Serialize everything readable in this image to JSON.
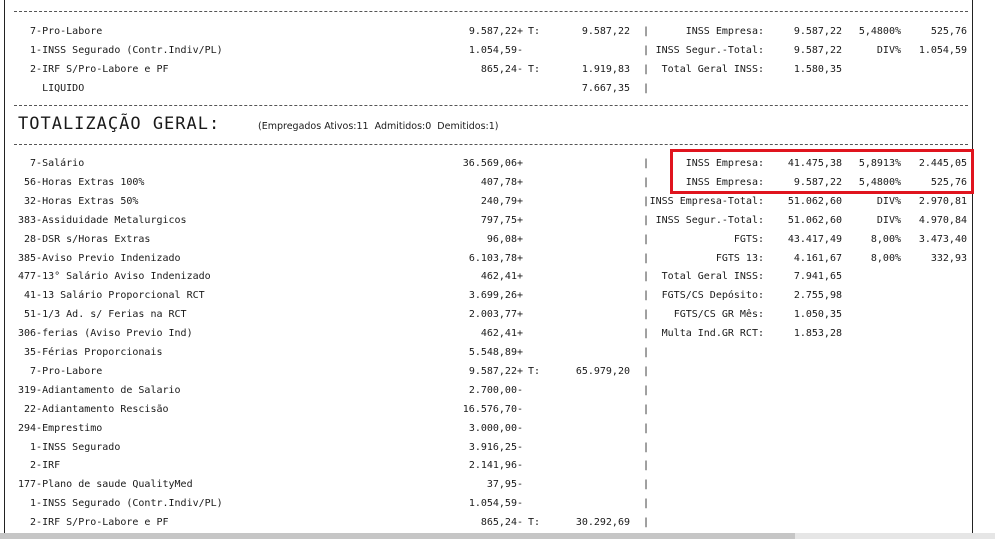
{
  "top": {
    "left_rows": [
      {
        "label": "  7-Pro-Labore",
        "value": "9.587,22+",
        "t": "T:",
        "total": "9.587,22"
      },
      {
        "label": "  1-INSS Segurado (Contr.Indiv/PL)",
        "value": "1.054,59-",
        "t": "",
        "total": ""
      },
      {
        "label": "  2-IRF S/Pro-Labore e PF",
        "value": "865,24-",
        "t": "T:",
        "total": "1.919,83"
      },
      {
        "label": "    LIQUIDO",
        "value": "",
        "t": "",
        "total": "7.667,35"
      }
    ],
    "right_rows": [
      {
        "label": "INSS Empresa:",
        "value": "9.587,22",
        "pct": "5,4800%",
        "total": "525,76"
      },
      {
        "label": "INSS Segur.-Total:",
        "value": "9.587,22",
        "pct": "DIV%",
        "total": "1.054,59"
      },
      {
        "label": "Total Geral INSS:",
        "value": "1.580,35",
        "pct": "",
        "total": ""
      }
    ]
  },
  "section": {
    "title": "TOTALIZAÇÃO GERAL:",
    "subtitle": "(Empregados Ativos:11  Admitidos:0  Demitidos:1)"
  },
  "main": {
    "left_rows": [
      {
        "label": "  7-Salário",
        "value": "36.569,06+",
        "t": "",
        "total": ""
      },
      {
        "label": " 56-Horas Extras 100%",
        "value": "407,78+",
        "t": "",
        "total": ""
      },
      {
        "label": " 32-Horas Extras 50%",
        "value": "240,79+",
        "t": "",
        "total": ""
      },
      {
        "label": "383-Assiduidade Metalurgicos",
        "value": "797,75+",
        "t": "",
        "total": ""
      },
      {
        "label": " 28-DSR s/Horas Extras",
        "value": "96,08+",
        "t": "",
        "total": ""
      },
      {
        "label": "385-Aviso Previo Indenizado",
        "value": "6.103,78+",
        "t": "",
        "total": ""
      },
      {
        "label": "477-13° Salário Aviso Indenizado",
        "value": "462,41+",
        "t": "",
        "total": ""
      },
      {
        "label": " 41-13 Salário Proporcional RCT",
        "value": "3.699,26+",
        "t": "",
        "total": ""
      },
      {
        "label": " 51-1/3 Ad. s/ Ferias na RCT",
        "value": "2.003,77+",
        "t": "",
        "total": ""
      },
      {
        "label": "306-ferias (Aviso Previo Ind)",
        "value": "462,41+",
        "t": "",
        "total": ""
      },
      {
        "label": " 35-Férias Proporcionais",
        "value": "5.548,89+",
        "t": "",
        "total": ""
      },
      {
        "label": "  7-Pro-Labore",
        "value": "9.587,22+",
        "t": "T:",
        "total": "65.979,20"
      },
      {
        "label": "319-Adiantamento de Salario",
        "value": "2.700,00-",
        "t": "",
        "total": ""
      },
      {
        "label": " 22-Adiantamento Rescisão",
        "value": "16.576,70-",
        "t": "",
        "total": ""
      },
      {
        "label": "294-Emprestimo",
        "value": "3.000,00-",
        "t": "",
        "total": ""
      },
      {
        "label": "  1-INSS Segurado",
        "value": "3.916,25-",
        "t": "",
        "total": ""
      },
      {
        "label": "  2-IRF",
        "value": "2.141,96-",
        "t": "",
        "total": ""
      },
      {
        "label": "177-Plano de saude QualityMed",
        "value": "37,95-",
        "t": "",
        "total": ""
      },
      {
        "label": "  1-INSS Segurado (Contr.Indiv/PL)",
        "value": "1.054,59-",
        "t": "",
        "total": ""
      },
      {
        "label": "  2-IRF S/Pro-Labore e PF",
        "value": "865,24-",
        "t": "T:",
        "total": "30.292,69"
      }
    ],
    "right_rows": [
      {
        "label": "INSS Empresa:",
        "value": "41.475,38",
        "pct": "5,8913%",
        "total": "2.445,05"
      },
      {
        "label": "INSS Empresa:",
        "value": "9.587,22",
        "pct": "5,4800%",
        "total": "525,76"
      },
      {
        "label": "INSS Empresa-Total:",
        "value": "51.062,60",
        "pct": "DIV%",
        "total": "2.970,81"
      },
      {
        "label": "INSS Segur.-Total:",
        "value": "51.062,60",
        "pct": "DIV%",
        "total": "4.970,84"
      },
      {
        "label": "FGTS:",
        "value": "43.417,49",
        "pct": "8,00%",
        "total": "3.473,40"
      },
      {
        "label": "FGTS 13:",
        "value": "4.161,67",
        "pct": "8,00%",
        "total": "332,93"
      },
      {
        "label": "Total Geral INSS:",
        "value": "7.941,65",
        "pct": "",
        "total": ""
      },
      {
        "label": "FGTS/CS Depósito:",
        "value": "2.755,98",
        "pct": "",
        "total": ""
      },
      {
        "label": "FGTS/CS GR Mês:",
        "value": "1.050,35",
        "pct": "",
        "total": ""
      },
      {
        "label": "Multa Ind.GR RCT:",
        "value": "1.853,28",
        "pct": "",
        "total": ""
      }
    ]
  },
  "colors": {
    "highlight": "#e0141e",
    "text": "#1a1a1a"
  }
}
